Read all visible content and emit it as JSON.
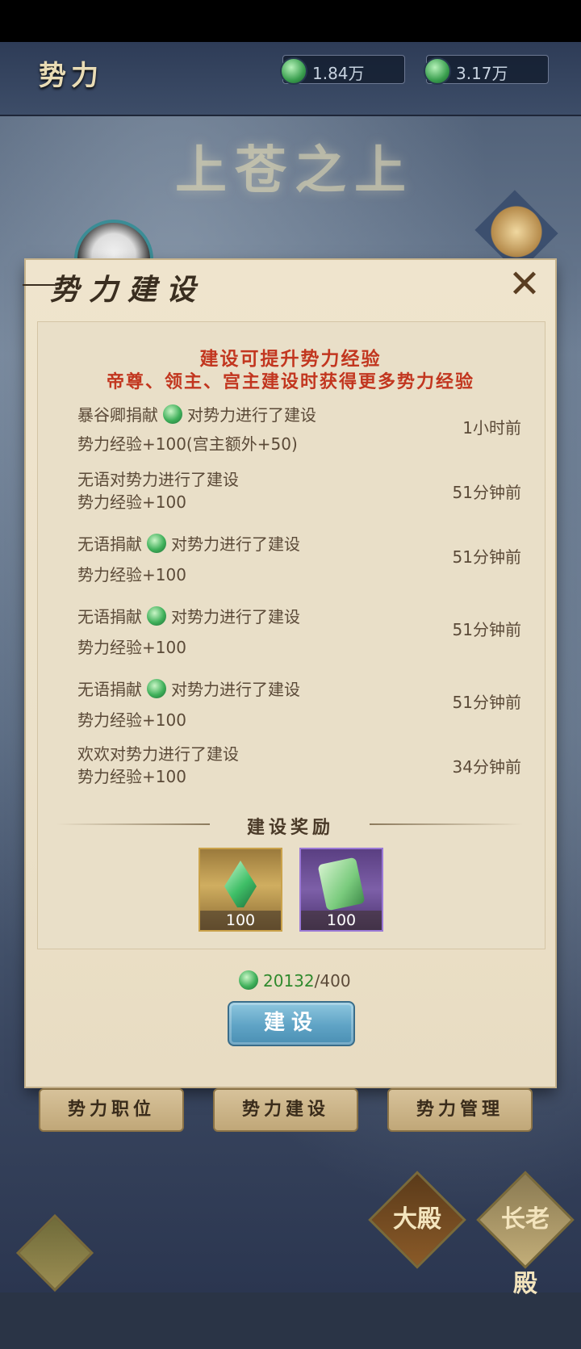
{
  "header": {
    "title": "势力",
    "currency1": "1.84万",
    "currency2": "3.17万",
    "banner": "上苍之上"
  },
  "panel": {
    "title": "势力建设",
    "notice_line1": "建设可提升势力经验",
    "notice_line2": "帝尊、领主、宫主建设时获得更多势力经验"
  },
  "logs": [
    {
      "line1_pre": "暴谷卿捐献",
      "coin": true,
      "line1_post": "对势力进行了建设",
      "line2": "势力经验+100(宫主额外+50)",
      "time": "1小时前"
    },
    {
      "line1_pre": "无语对势力进行了建设",
      "coin": false,
      "line1_post": "",
      "line2": "势力经验+100",
      "time": "51分钟前"
    },
    {
      "line1_pre": "无语捐献",
      "coin": true,
      "line1_post": "对势力进行了建设",
      "line2": "势力经验+100",
      "time": "51分钟前"
    },
    {
      "line1_pre": "无语捐献",
      "coin": true,
      "line1_post": "对势力进行了建设",
      "line2": "势力经验+100",
      "time": "51分钟前"
    },
    {
      "line1_pre": "无语捐献",
      "coin": true,
      "line1_post": "对势力进行了建设",
      "line2": "势力经验+100",
      "time": "51分钟前"
    },
    {
      "line1_pre": "欢欢对势力进行了建设",
      "coin": false,
      "line1_post": "",
      "line2": "势力经验+100",
      "time": "34分钟前"
    }
  ],
  "rewards": {
    "title": "建设奖励",
    "items": [
      {
        "icon": "green-crystal-icon",
        "count": "100"
      },
      {
        "icon": "jade-ticket-icon",
        "count": "100"
      }
    ]
  },
  "cost": {
    "have": "20132",
    "need": "/400"
  },
  "build_button": "建设",
  "tabs": [
    "势力职位",
    "势力建设",
    "势力管理"
  ],
  "bottom_nav": {
    "main_hall": "大殿",
    "elder_hall": "长老殿"
  }
}
